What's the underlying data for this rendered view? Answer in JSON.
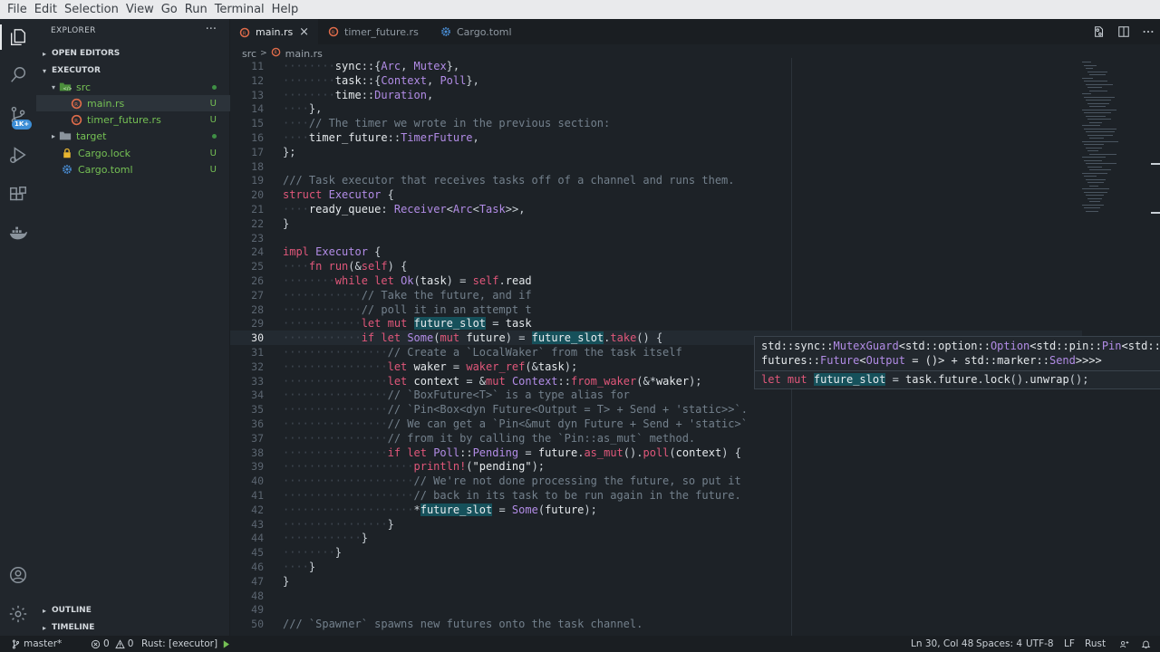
{
  "menu": [
    "File",
    "Edit",
    "Selection",
    "View",
    "Go",
    "Run",
    "Terminal",
    "Help"
  ],
  "activity": {
    "badge": "1K+"
  },
  "sidebar": {
    "title": "EXPLORER",
    "more": "···",
    "open_editors": "OPEN EDITORS",
    "folder": "EXECUTOR",
    "tree": [
      {
        "label": "src",
        "status": "dot"
      },
      {
        "label": "main.rs",
        "status": "U"
      },
      {
        "label": "timer_future.rs",
        "status": "U"
      },
      {
        "label": "target",
        "status": "dot"
      },
      {
        "label": "Cargo.lock",
        "status": "U"
      },
      {
        "label": "Cargo.toml",
        "status": "U"
      }
    ],
    "outline": "OUTLINE",
    "timeline": "TIMELINE"
  },
  "tabs": [
    {
      "label": "main.rs",
      "active": true,
      "close": "×"
    },
    {
      "label": "timer_future.rs",
      "active": false
    },
    {
      "label": "Cargo.toml",
      "active": false
    }
  ],
  "breadcrumb": {
    "folder": "src",
    "file": "main.rs",
    "sep": ">"
  },
  "editor": {
    "current_line": 30,
    "lines": [
      {
        "n": "11",
        "code": "        sync::{Arc, Mutex},"
      },
      {
        "n": "12",
        "code": "        task::{Context, Poll},"
      },
      {
        "n": "13",
        "code": "        time::Duration,"
      },
      {
        "n": "14",
        "code": "    },"
      },
      {
        "n": "15",
        "code": "    // The timer we wrote in the previous section:"
      },
      {
        "n": "16",
        "code": "    timer_future::TimerFuture,"
      },
      {
        "n": "17",
        "code": "};"
      },
      {
        "n": "18",
        "code": ""
      },
      {
        "n": "19",
        "code": "/// Task executor that receives tasks off of a channel and runs them."
      },
      {
        "n": "20",
        "code": "struct Executor {"
      },
      {
        "n": "21",
        "code": "    ready_queue: Receiver<Arc<Task>>,"
      },
      {
        "n": "22",
        "code": "}"
      },
      {
        "n": "23",
        "code": ""
      },
      {
        "n": "24",
        "code": "impl Executor {"
      },
      {
        "n": "25",
        "code": "    fn run(&self) {"
      },
      {
        "n": "26",
        "code": "        while let Ok(task) = self.read"
      },
      {
        "n": "27",
        "code": "            // Take the future, and if"
      },
      {
        "n": "28",
        "code": "            // poll it in an attempt t"
      },
      {
        "n": "29",
        "code": "            let mut future_slot = task"
      },
      {
        "n": "30",
        "code": "            if let Some(mut future) = future_slot.take() {"
      },
      {
        "n": "31",
        "code": "                // Create a `LocalWaker` from the task itself"
      },
      {
        "n": "32",
        "code": "                let waker = waker_ref(&task);"
      },
      {
        "n": "33",
        "code": "                let context = &mut Context::from_waker(&*waker);"
      },
      {
        "n": "34",
        "code": "                // `BoxFuture<T>` is a type alias for"
      },
      {
        "n": "35",
        "code": "                // `Pin<Box<dyn Future<Output = T> + Send + 'static>>`."
      },
      {
        "n": "36",
        "code": "                // We can get a `Pin<&mut dyn Future + Send + 'static>`"
      },
      {
        "n": "37",
        "code": "                // from it by calling the `Pin::as_mut` method."
      },
      {
        "n": "38",
        "code": "                if let Poll::Pending = future.as_mut().poll(context) {"
      },
      {
        "n": "39",
        "code": "                    println!(\"pending\");"
      },
      {
        "n": "40",
        "code": "                    // We're not done processing the future, so put it"
      },
      {
        "n": "41",
        "code": "                    // back in its task to be run again in the future."
      },
      {
        "n": "42",
        "code": "                    *future_slot = Some(future);"
      },
      {
        "n": "43",
        "code": "                }"
      },
      {
        "n": "44",
        "code": "            }"
      },
      {
        "n": "45",
        "code": "        }"
      },
      {
        "n": "46",
        "code": "    }"
      },
      {
        "n": "47",
        "code": "}"
      },
      {
        "n": "48",
        "code": ""
      },
      {
        "n": "49",
        "code": ""
      },
      {
        "n": "50",
        "code": "/// `Spawner` spawns new futures onto the task channel."
      }
    ]
  },
  "hover": {
    "line1": "std::sync::MutexGuard<std::option::Option<std::pin::Pin<std::boxed::Box<dyn",
    "line2": "futures::Future<Output = ()> + std::marker::Send>>>>",
    "line3": "let mut future_slot = task.future.lock().unwrap();"
  },
  "status": {
    "branch": "master*",
    "errors": "0",
    "warnings": "0",
    "rust": "Rust: [executor]",
    "position": "Ln 30, Col 48",
    "spaces": "Spaces: 4",
    "encoding": "UTF-8",
    "eol": "LF",
    "language": "Rust"
  },
  "colors": {
    "accent_green": "#75c054",
    "rust_icon": "#e06c4a",
    "toml_icon": "#4a90d9"
  }
}
